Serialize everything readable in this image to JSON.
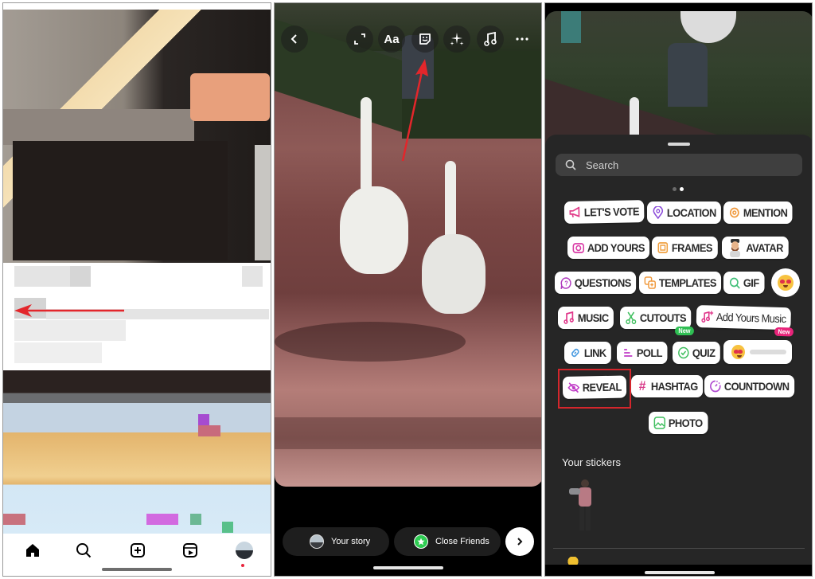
{
  "panel1": {
    "bottom_nav": {
      "items": [
        {
          "name": "home",
          "icon": "home-icon",
          "active": true
        },
        {
          "name": "search",
          "icon": "search-icon"
        },
        {
          "name": "create",
          "icon": "plus-square-icon"
        },
        {
          "name": "reels",
          "icon": "reels-icon"
        },
        {
          "name": "profile",
          "icon": "avatar-icon",
          "notification_dot": true
        }
      ]
    },
    "annotation": "swipe-left-arrow"
  },
  "panel2": {
    "toolbar": {
      "back": "back-icon",
      "resize": "resize-icon",
      "text_label": "Aa",
      "sticker": "sticker-icon",
      "effects": "sparkles-icon",
      "music": "music-note-icon",
      "more": "more-icon"
    },
    "share": {
      "your_story_label": "Your story",
      "close_friends_label": "Close Friends",
      "next": "chevron-right-icon"
    },
    "accent_colors": {
      "close_friends": "#2ecc52",
      "annotation_arrow": "#e3262b"
    }
  },
  "panel3": {
    "search": {
      "placeholder": "Search"
    },
    "page_dots": {
      "count": 2,
      "active_index": 1
    },
    "stickers": [
      {
        "label": "LET'S VOTE",
        "icon": "megaphone-icon",
        "color": "#e23d8a"
      },
      {
        "label": "LOCATION",
        "icon": "location-pin-icon",
        "color": "#8a4ad9"
      },
      {
        "label": "MENTION",
        "icon": "at-icon",
        "color": "#f09a3e"
      },
      {
        "label": "ADD YOURS",
        "icon": "camera-icon",
        "color": "#d93ba6"
      },
      {
        "label": "FRAMES",
        "icon": "frame-icon",
        "color": "#f0a040"
      },
      {
        "label": "AVATAR",
        "icon": "avatar-icon",
        "color": "#c58a5c"
      },
      {
        "label": "QUESTIONS",
        "icon": "question-bubble-icon",
        "color": "#b03bbf"
      },
      {
        "label": "TEMPLATES",
        "icon": "templates-icon",
        "color": "#f09a3e"
      },
      {
        "label": "GIF",
        "icon": "search-icon",
        "color": "#3fbf77"
      },
      {
        "label": "",
        "icon": "heart-eyes-emoji-icon",
        "color": "#f7c240"
      },
      {
        "label": "MUSIC",
        "icon": "music-note-icon",
        "color": "#e0368a"
      },
      {
        "label": "CUTOUTS",
        "icon": "scissors-icon",
        "color": "#3fbf5e",
        "badge": "New",
        "badge_color": "#2fbf53"
      },
      {
        "label": "Add Yours Music",
        "icon": "music-plus-icon",
        "color": "#e0368a",
        "badge": "New",
        "badge_color": "#e8247a"
      },
      {
        "label": "LINK",
        "icon": "link-icon",
        "color": "#4a9be0"
      },
      {
        "label": "POLL",
        "icon": "poll-icon",
        "color": "#c03bc7"
      },
      {
        "label": "QUIZ",
        "icon": "check-circle-icon",
        "color": "#3fbf5e"
      },
      {
        "label": "",
        "icon": "emoji-slider-icon",
        "color": "#f7c240"
      },
      {
        "label": "REVEAL",
        "icon": "eye-off-icon",
        "color": "#c03bc7",
        "highlighted": true
      },
      {
        "label": "HASHTAG",
        "icon": "hashtag-icon",
        "color": "#d93b8a"
      },
      {
        "label": "COUNTDOWN",
        "icon": "timer-icon",
        "color": "#b04ad0"
      },
      {
        "label": "PHOTO",
        "icon": "image-icon",
        "color": "#3fbf5e"
      }
    ],
    "your_stickers_heading": "Your stickers",
    "highlight_color": "#d4262c"
  }
}
